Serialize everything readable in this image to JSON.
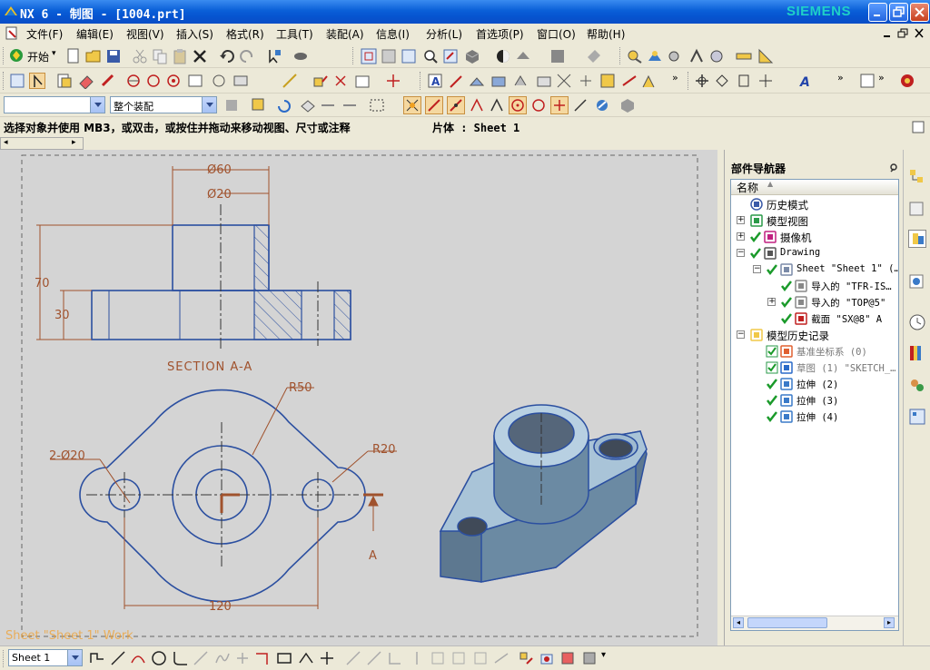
{
  "window": {
    "title": "NX 6 - 制图 - [1004.prt]",
    "brand": "SIEMENS",
    "buttons": [
      "minimize",
      "restore",
      "close"
    ]
  },
  "menu": {
    "items": [
      {
        "label": "文件(F)"
      },
      {
        "label": "编辑(E)"
      },
      {
        "label": "视图(V)"
      },
      {
        "label": "插入(S)"
      },
      {
        "label": "格式(R)"
      },
      {
        "label": "工具(T)"
      },
      {
        "label": "装配(A)"
      },
      {
        "label": "信息(I)"
      },
      {
        "label": "分析(L)"
      },
      {
        "label": "首选项(P)"
      },
      {
        "label": "窗口(O)"
      },
      {
        "label": "帮助(H)"
      }
    ]
  },
  "toolbar": {
    "start_label": "开始",
    "filter_combo_value": "",
    "assembly_combo_value": "整个装配"
  },
  "status": {
    "prompt": "选择对象并使用 MB3，或双击，或按住并拖动来移动视图、尺寸或注释",
    "sheet_label": "片体 : Sheet 1"
  },
  "drawing": {
    "section_title": "SECTION  A-A",
    "dim_d60": "Ø60",
    "dim_d20": "Ø20",
    "dim_70": "70",
    "dim_30": "30",
    "dim_r50": "R50",
    "dim_r20": "R20",
    "dim_holes": "2-Ø20",
    "dim_120": "120",
    "section_arrow_label": "A",
    "sheet_watermark": "Sheet \"Sheet 1\" Work",
    "colors": {
      "geometry": "#2b4fa0",
      "dimension": "#a0522d",
      "background": "#d4d4d4",
      "model": "#a9c4d8"
    }
  },
  "navigator": {
    "title": "部件导航器",
    "column_header": "名称",
    "items": [
      {
        "label": "历史模式",
        "icon": "clock-icon",
        "level": 0
      },
      {
        "label": "模型视图",
        "icon": "model-views-icon",
        "level": 0
      },
      {
        "label": "摄像机",
        "icon": "camera-icon",
        "level": 0
      },
      {
        "label": "Drawing",
        "icon": "drawing-icon",
        "level": 0
      },
      {
        "label": "Sheet \"Sheet 1\" (…",
        "icon": "sheet-icon",
        "level": 1
      },
      {
        "label": "导入的 \"TFR-IS…",
        "icon": "imported-view-icon",
        "level": 2
      },
      {
        "label": "导入的 \"TOP@5\"",
        "icon": "imported-view-icon",
        "level": 2
      },
      {
        "label": "截面 \"SX@8\" A",
        "icon": "section-view-icon",
        "level": 2
      },
      {
        "label": "模型历史记录",
        "icon": "folder-icon",
        "level": 0
      },
      {
        "label": "基准坐标系 (0)",
        "icon": "datum-csys-icon",
        "level": 1
      },
      {
        "label": "草图 (1) \"SKETCH_…",
        "icon": "sketch-icon",
        "level": 1
      },
      {
        "label": "拉伸 (2)",
        "icon": "extrude-icon",
        "level": 1
      },
      {
        "label": "拉伸 (3)",
        "icon": "extrude-icon",
        "level": 1
      },
      {
        "label": "拉伸 (4)",
        "icon": "extrude-icon",
        "level": 1
      }
    ]
  },
  "bottom": {
    "sheet_combo_value": "Sheet 1"
  }
}
